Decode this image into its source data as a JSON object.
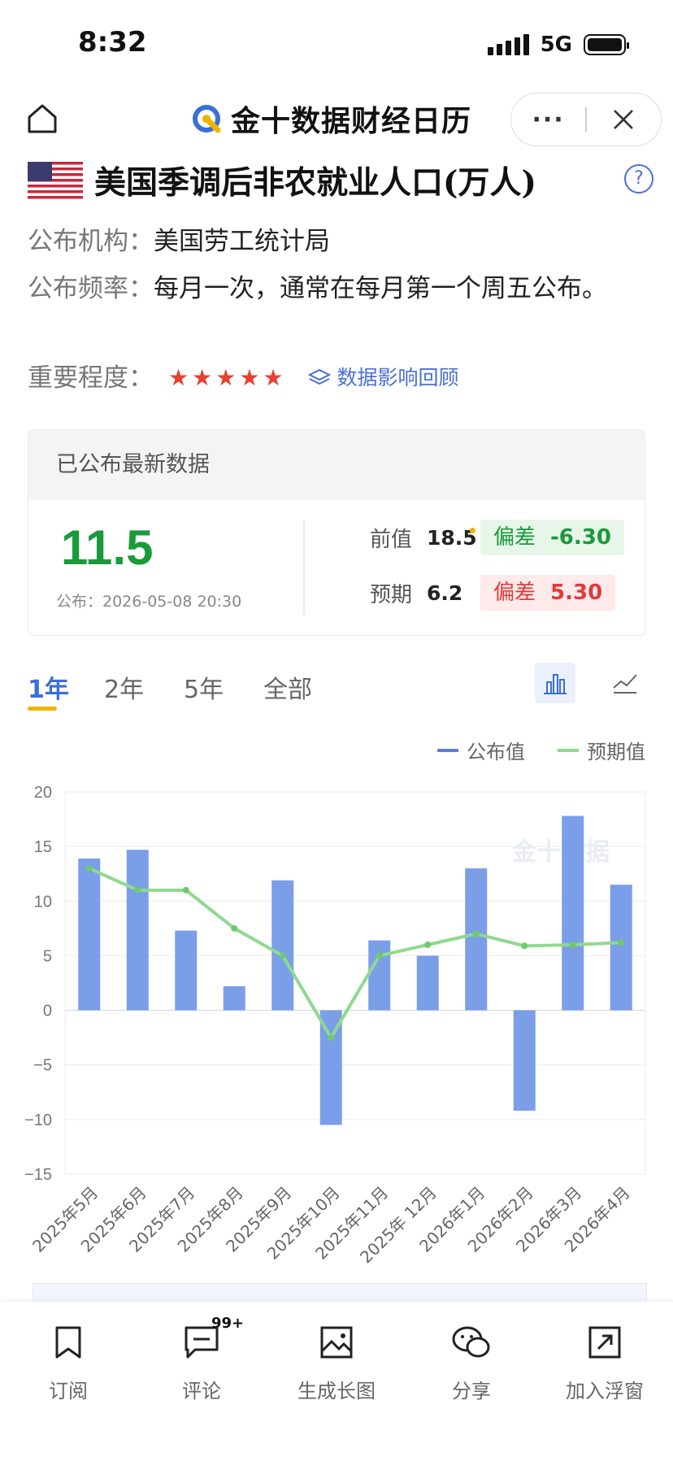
{
  "status": {
    "time": "8:32",
    "network": "5G"
  },
  "nav": {
    "brand": "金十数据财经日历",
    "more": "···"
  },
  "indicator": {
    "title": "美国季调后非农就业人口(万人)",
    "publisher_label": "公布机构：",
    "publisher": "美国劳工统计局",
    "frequency_label": "公布频率：",
    "frequency": "每月一次，通常在每月第一个周五公布。",
    "importance_label": "重要程度：",
    "importance_stars": 5,
    "review_link": "数据影响回顾"
  },
  "latest": {
    "header": "已公布最新数据",
    "actual": "11.5",
    "published": "公布：2026-05-08 20:30",
    "previous_label": "前值",
    "previous": "18.5",
    "forecast_label": "预期",
    "forecast": "6.2",
    "deviation_label": "偏差",
    "deviation_prev": "-6.30",
    "deviation_forecast": "5.30"
  },
  "range_tabs": [
    "1年",
    "2年",
    "5年",
    "全部"
  ],
  "active_tab": "1年",
  "colors": {
    "accent": "#3b6fd8",
    "bar": "#7b9ee8",
    "line": "#8fd98f",
    "up": "#1a9a3a",
    "down": "#e03b3b"
  },
  "chart_data": {
    "type": "bar",
    "categories": [
      "2025年5月",
      "2025年6月",
      "2025年7月",
      "2025年8月",
      "2025年9月",
      "2025年10月",
      "2025年11月",
      "2025年 12月",
      "2026年1月",
      "2026年2月",
      "2026年3月",
      "2026年4月"
    ],
    "series": [
      {
        "name": "公布值",
        "type": "bar",
        "values": [
          13.9,
          14.7,
          7.3,
          2.2,
          11.9,
          -10.5,
          6.4,
          5.0,
          13.0,
          -9.2,
          17.8,
          11.5
        ]
      },
      {
        "name": "预期值",
        "type": "line",
        "values": [
          13.0,
          11.0,
          11.0,
          7.5,
          5.0,
          -2.5,
          5.0,
          6.0,
          7.0,
          5.9,
          6.0,
          6.2
        ]
      }
    ],
    "ylim": [
      -15,
      20
    ],
    "yticks": [
      20,
      15,
      10,
      5,
      0,
      -5,
      -10,
      -15
    ],
    "ytick_labels": [
      "20",
      "15",
      "10",
      "5",
      "0",
      "−5",
      "−10",
      "−15"
    ],
    "grid": true,
    "legend": "top-right",
    "watermark": "金十数据"
  },
  "bottom_bar": {
    "subscribe": "订阅",
    "comments": "评论",
    "comments_badge": "99+",
    "long_image": "生成长图",
    "share": "分享",
    "float_window": "加入浮窗"
  }
}
